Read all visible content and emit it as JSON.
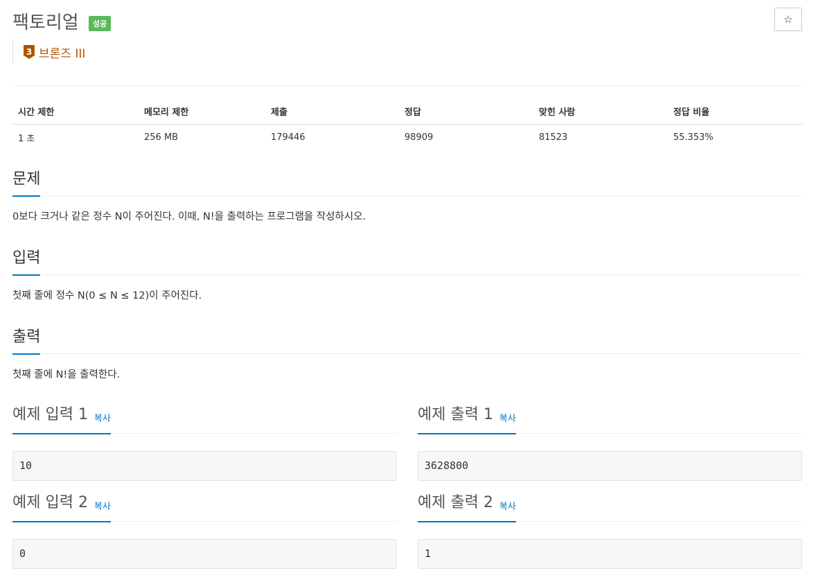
{
  "problem": {
    "title": "팩토리얼",
    "status_badge": "성공",
    "star_icon": "☆",
    "tier": {
      "number": "3",
      "label": "브론즈 III",
      "color": "#ad5600"
    }
  },
  "info_table": {
    "headers": [
      "시간 제한",
      "메모리 제한",
      "제출",
      "정답",
      "맞힌 사람",
      "정답 비율"
    ],
    "values": [
      "1 초",
      "256 MB",
      "179446",
      "98909",
      "81523",
      "55.353%"
    ]
  },
  "sections": {
    "description": {
      "title": "문제",
      "text": "0보다 크거나 같은 정수 N이 주어진다. 이때, N!을 출력하는 프로그램을 작성하시오."
    },
    "input": {
      "title": "입력",
      "text": "첫째 줄에 정수 N(0 ≤ N ≤ 12)이 주어진다."
    },
    "output": {
      "title": "출력",
      "text": "첫째 줄에 N!을 출력한다."
    }
  },
  "samples": {
    "copy_label": "복사",
    "input1": {
      "title": "예제 입력 1",
      "value": "10"
    },
    "output1": {
      "title": "예제 출력 1",
      "value": "3628800"
    },
    "input2": {
      "title": "예제 입력 2",
      "value": "0"
    },
    "output2": {
      "title": "예제 출력 2",
      "value": "1"
    }
  },
  "colors": {
    "accent": "#0076c0",
    "success": "#5cb85c"
  }
}
